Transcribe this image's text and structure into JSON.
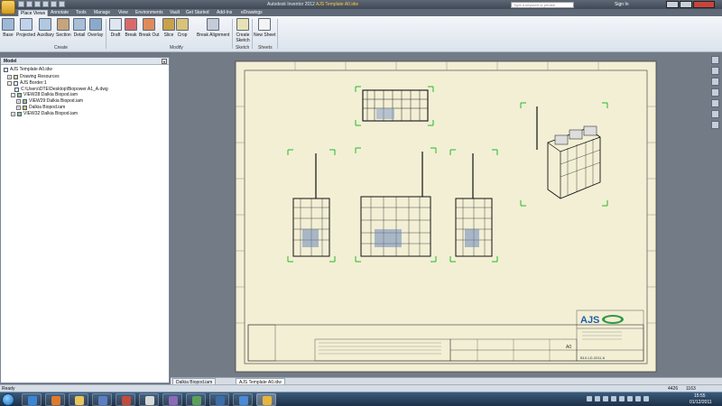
{
  "window": {
    "app_title": "Autodesk Inventor 2012",
    "doc_title": "AJS Template A0.idw",
    "search_placeholder": "Type a keyword or phrase",
    "sign_in": "Sign In"
  },
  "tabs": [
    {
      "label": "Place Views",
      "active": true
    },
    {
      "label": "Annotate"
    },
    {
      "label": "Tools"
    },
    {
      "label": "Manage"
    },
    {
      "label": "View"
    },
    {
      "label": "Environments"
    },
    {
      "label": "Vault"
    },
    {
      "label": "Get Started"
    },
    {
      "label": "Add-Ins"
    },
    {
      "label": "eDrawings"
    }
  ],
  "ribbon": {
    "create": {
      "label": "Create",
      "buttons": [
        "Base",
        "Projected",
        "Auxiliary",
        "Section",
        "Detail",
        "Overlay"
      ]
    },
    "modify": {
      "label": "Modify",
      "buttons": [
        "Draft",
        "Break",
        "Break Out",
        "Slice",
        "Crop",
        "Break Alignment"
      ]
    },
    "sketch": {
      "label": "Sketch",
      "button": "Create Sketch"
    },
    "sheets": {
      "label": "Sheets",
      "button": "New Sheet"
    }
  },
  "browser": {
    "title": "Model",
    "tree": [
      {
        "label": "AJS Template A0.idw",
        "level": 0
      },
      {
        "label": "Drawing Resources",
        "level": 1
      },
      {
        "label": "AJS Border:1",
        "level": 1
      },
      {
        "label": "C:\\Users\\DTE\\Desktop\\Biopower A1_A.dwg",
        "level": 2
      },
      {
        "label": "VIEW28:Dalkia Biopod.iam",
        "level": 1
      },
      {
        "label": "VIEW29:Dalkia Biopod.iam",
        "level": 2
      },
      {
        "label": "Dalkia Biopod.iam",
        "level": 2
      },
      {
        "label": "VIEW32:Dalkia Biopod.iam",
        "level": 1
      }
    ]
  },
  "drawing": {
    "logo": "AJS",
    "sheet_number": "A0",
    "drawing_number": "B10-LD-2011-6"
  },
  "doc_tabs": [
    {
      "label": "Dalkia Biopod.iam",
      "active": false
    },
    {
      "label": "AJS Template A0.idw",
      "active": true
    }
  ],
  "status": {
    "text": "Ready",
    "x": "4426",
    "y": "1163"
  },
  "clock": {
    "time": "15:55",
    "date": "01/12/2011"
  },
  "colors": {
    "sheet": "#f2efd5",
    "view_corner": "#22bb22",
    "ribbon_active_tab": "#e9eef5"
  }
}
